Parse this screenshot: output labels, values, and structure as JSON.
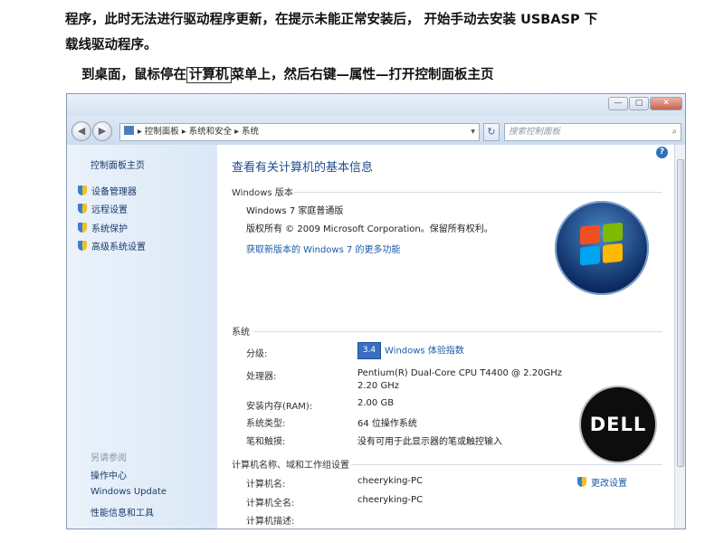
{
  "doc": {
    "line1": "程序，此时无法进行驱动程序更新，在提示未能正常安装后，  开始手动去安装 USBASP 下",
    "line2": "载线驱动程序。",
    "line3_pre": "到桌面，鼠标停在",
    "line3_box": "计算机",
    "line3_post": "菜单上，然后右键—属性—打开控制面板主页"
  },
  "window": {
    "controls": [
      "—",
      "▢",
      "✕"
    ],
    "address": [
      "控制面板",
      "系统和安全",
      "系统"
    ],
    "search_placeholder": "搜索控制面板",
    "help": "?"
  },
  "sidebar": {
    "home": "控制面板主页",
    "tasks": [
      "设备管理器",
      "远程设置",
      "系统保护",
      "高级系统设置"
    ],
    "see_also_title": "另请参阅",
    "see_also": [
      "操作中心",
      "Windows Update",
      "性能信息和工具"
    ]
  },
  "content": {
    "heading": "查看有关计算机的基本信息",
    "edition_section": "Windows 版本",
    "edition": "Windows 7 家庭普通版",
    "copyright": "版权所有 © 2009 Microsoft Corporation。保留所有权利。",
    "upgrade_link": "获取新版本的 Windows 7 的更多功能",
    "system_section": "系统",
    "rating_label": "分级:",
    "rating_value": "3.4",
    "rating_link": "Windows 体验指数",
    "processor_label": "处理器:",
    "processor_value": "Pentium(R) Dual-Core CPU      T4400  @ 2.20GHz",
    "processor_value2": "2.20 GHz",
    "ram_label": "安装内存(RAM):",
    "ram_value": "2.00 GB",
    "type_label": "系统类型:",
    "type_value": "64 位操作系统",
    "pen_label": "笔和触摸:",
    "pen_value": "没有可用于此显示器的笔或触控输入",
    "name_section": "计算机名称、域和工作组设置",
    "comp_name_label": "计算机名:",
    "comp_name_value": "cheeryking-PC",
    "full_name_label": "计算机全名:",
    "full_name_value": "cheeryking-PC",
    "desc_label": "计算机描述:",
    "change_settings": "更改设置",
    "dell_logo": "DELL"
  }
}
